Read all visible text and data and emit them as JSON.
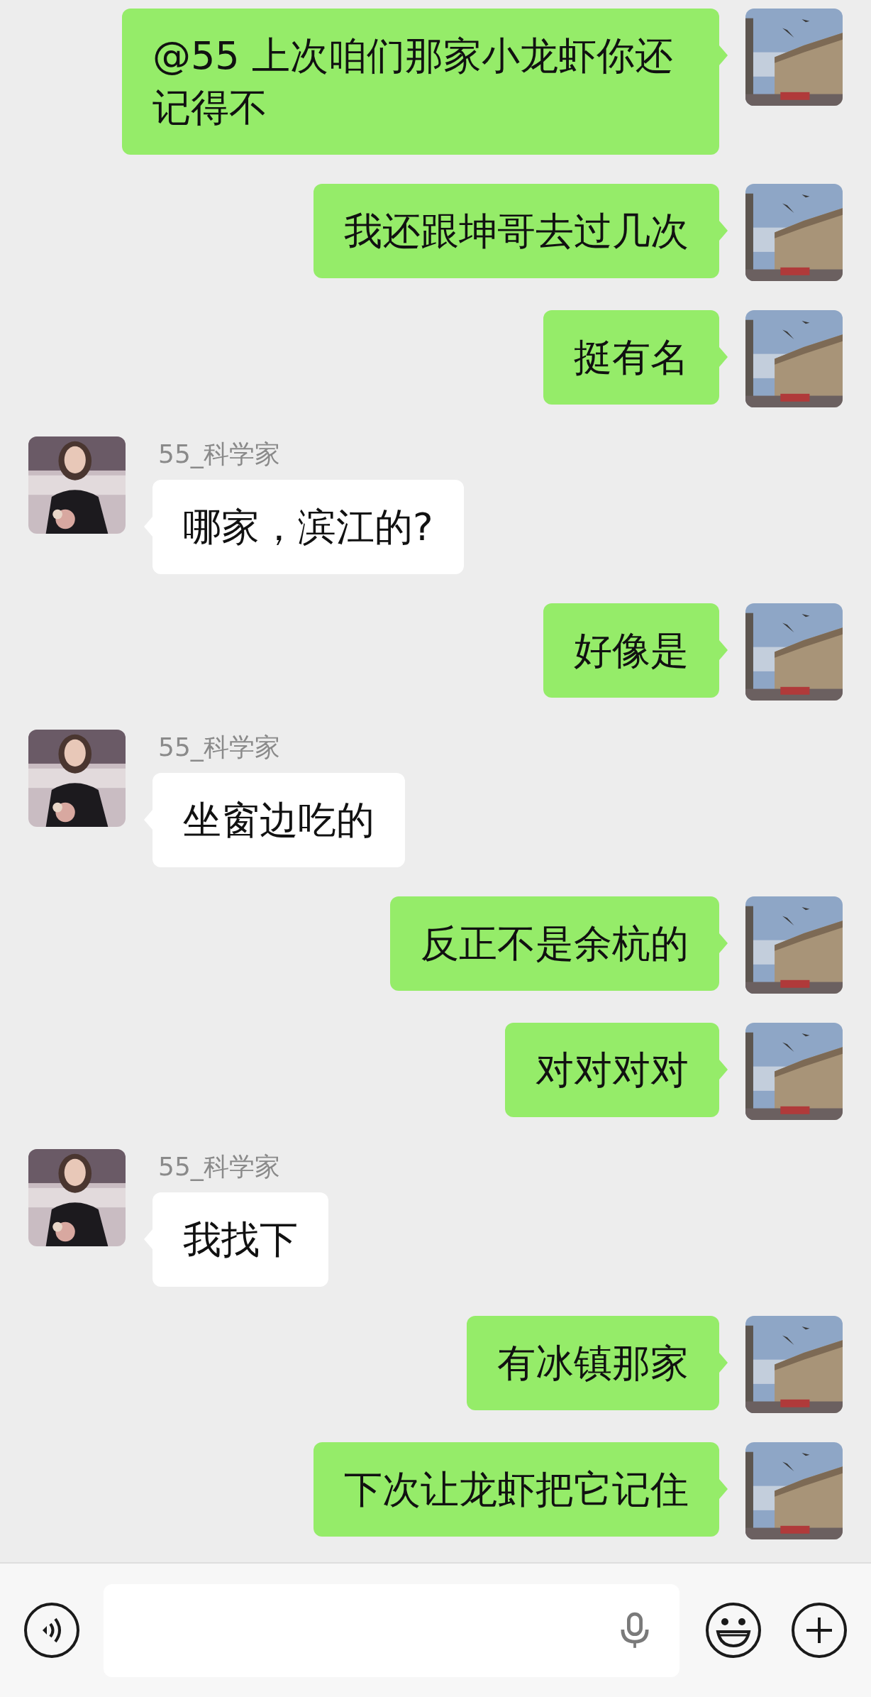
{
  "messages": [
    {
      "kind": "sent",
      "text": "@55 上次咱们那家小龙虾你还记得不"
    },
    {
      "kind": "sent",
      "text": "我还跟坤哥去过几次"
    },
    {
      "kind": "sent",
      "text": "挺有名"
    },
    {
      "kind": "received",
      "sender": "55_科学家",
      "text": "哪家，滨江的?"
    },
    {
      "kind": "sent",
      "text": "好像是"
    },
    {
      "kind": "received",
      "sender": "55_科学家",
      "text": "坐窗边吃的"
    },
    {
      "kind": "sent",
      "text": "反正不是余杭的"
    },
    {
      "kind": "sent",
      "text": "对对对对"
    },
    {
      "kind": "received",
      "sender": "55_科学家",
      "text": "我找下"
    },
    {
      "kind": "sent",
      "text": "有冰镇那家"
    },
    {
      "kind": "sent",
      "text": "下次让龙虾把它记住"
    }
  ]
}
